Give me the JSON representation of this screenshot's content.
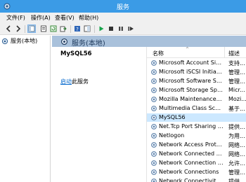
{
  "window": {
    "title": "服务"
  },
  "menu": [
    {
      "label": "文件(F)"
    },
    {
      "label": "操作(A)"
    },
    {
      "label": "查看(V)"
    },
    {
      "label": "帮助(H)"
    }
  ],
  "toolbar": {
    "icons": [
      "back-icon",
      "forward-icon",
      "console-tree-icon",
      "properties-icon",
      "refresh-icon",
      "export-icon",
      "help-icon",
      "show-hide-icon",
      "play-icon",
      "stop-icon",
      "pause-icon",
      "restart-icon"
    ]
  },
  "tree": {
    "item_label": "服务(本地)"
  },
  "pane": {
    "header": "服务(本地)"
  },
  "selected_service": {
    "name": "MySQL56",
    "start_link": "启动",
    "start_suffix": "此服务"
  },
  "list": {
    "columns": {
      "name": "名称",
      "description": "描述"
    },
    "rows": [
      {
        "name": "Microsoft Account Sign-i...",
        "desc": "支持..."
      },
      {
        "name": "Microsoft iSCSI Initiator ...",
        "desc": "管理..."
      },
      {
        "name": "Microsoft Software Shad...",
        "desc": "管理..."
      },
      {
        "name": "Microsoft Storage Space...",
        "desc": "Micr..."
      },
      {
        "name": "Mozilla Maintenance Ser...",
        "desc": "Mozi..."
      },
      {
        "name": "Multimedia Class Schedu...",
        "desc": "基于..."
      },
      {
        "name": "MySQL56",
        "desc": "",
        "selected": true
      },
      {
        "name": "Net.Tcp Port Sharing Ser...",
        "desc": "提供..."
      },
      {
        "name": "Netlogon",
        "desc": "为用..."
      },
      {
        "name": "Network Access Protecti...",
        "desc": "网络..."
      },
      {
        "name": "Network Connected Devi...",
        "desc": "网络..."
      },
      {
        "name": "Network Connection Bro...",
        "desc": "允许..."
      },
      {
        "name": "Network Connections",
        "desc": "管理..."
      },
      {
        "name": "Network Connectivity Ass...",
        "desc": "提供..."
      }
    ]
  },
  "colors": {
    "titlebar": "#3b9be6",
    "pane_header": "#a9c1db",
    "selection": "#cce8ff",
    "play": "#16a34a",
    "link": "#0066cc"
  }
}
